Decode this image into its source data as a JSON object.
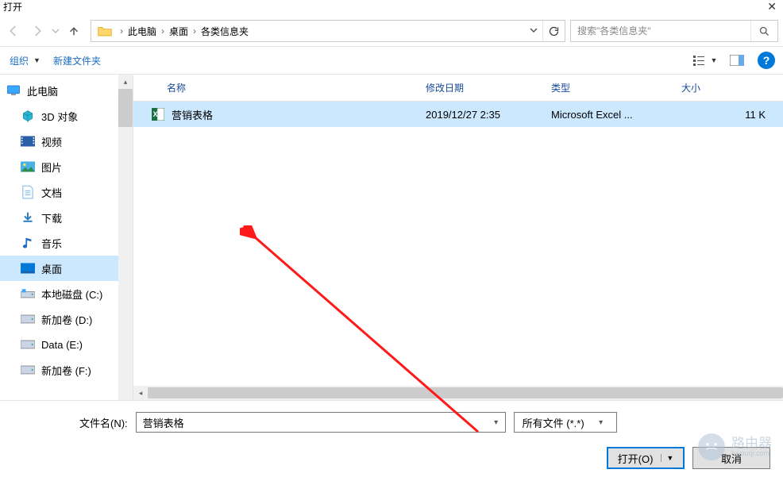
{
  "title": "打开",
  "breadcrumb": {
    "parts": [
      "此电脑",
      "桌面",
      "各类信息夹"
    ]
  },
  "search": {
    "placeholder": "搜索\"各类信息夹\""
  },
  "toolbar": {
    "organize": "组织",
    "newfolder": "新建文件夹"
  },
  "tree": {
    "items": [
      {
        "label": "此电脑",
        "icon": "pc"
      },
      {
        "label": "3D 对象",
        "icon": "3d",
        "indent": 1
      },
      {
        "label": "视频",
        "icon": "video",
        "indent": 1
      },
      {
        "label": "图片",
        "icon": "picture",
        "indent": 1
      },
      {
        "label": "文档",
        "icon": "document",
        "indent": 1
      },
      {
        "label": "下载",
        "icon": "download",
        "indent": 1
      },
      {
        "label": "音乐",
        "icon": "music",
        "indent": 1
      },
      {
        "label": "桌面",
        "icon": "desktop",
        "indent": 1,
        "selected": true
      },
      {
        "label": "本地磁盘 (C:)",
        "icon": "disk-c",
        "indent": 1
      },
      {
        "label": "新加卷 (D:)",
        "icon": "disk",
        "indent": 1
      },
      {
        "label": "Data (E:)",
        "icon": "disk",
        "indent": 1
      },
      {
        "label": "新加卷 (F:)",
        "icon": "disk",
        "indent": 1
      }
    ]
  },
  "columns": {
    "name": "名称",
    "date": "修改日期",
    "type": "类型",
    "size": "大小"
  },
  "files": [
    {
      "name": "营销表格",
      "date": "2019/12/27 2:35",
      "type": "Microsoft Excel ...",
      "size": "11 K",
      "selected": true
    }
  ],
  "bottom": {
    "filename_label": "文件名(N):",
    "filename_value": "营销表格",
    "filetype": "所有文件 (*.*)",
    "open": "打开(O)",
    "cancel": "取消"
  },
  "watermark": {
    "text": "路由器",
    "sub": "luyouqi.com"
  }
}
